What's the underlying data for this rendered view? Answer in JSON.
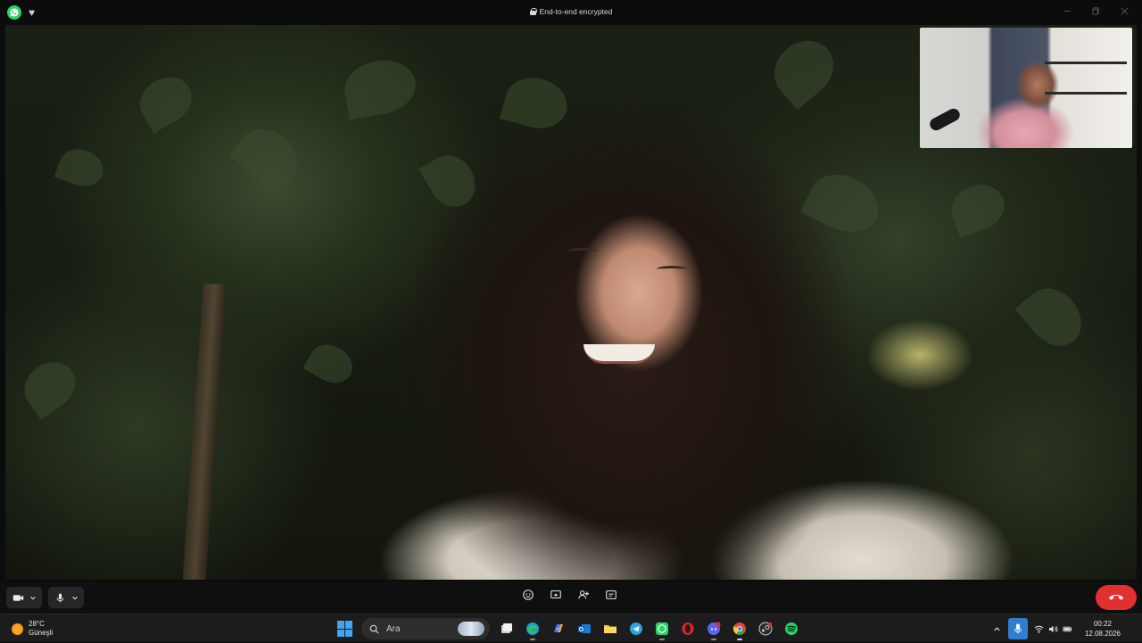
{
  "titlebar": {
    "encryption_label": "End-to-end encrypted",
    "app_icon": "whatsapp-icon",
    "secondary_icon": "heart-icon"
  },
  "window_controls": [
    "minimize",
    "maximize",
    "close"
  ],
  "call_controls": {
    "left": [
      {
        "icon": "video-camera-icon"
      },
      {
        "icon": "microphone-icon"
      }
    ],
    "center": [
      {
        "icon": "emoji-icon"
      },
      {
        "icon": "screen-share-icon"
      },
      {
        "icon": "add-person-icon"
      },
      {
        "icon": "more-options-icon"
      }
    ],
    "end_call_icon": "phone-hangup-icon",
    "end_call_color": "#e0302f"
  },
  "taskbar": {
    "weather": {
      "temp": "28°C",
      "location": "Güneşli",
      "icon": "sun-icon"
    },
    "search": {
      "placeholder": "Ara"
    },
    "apps": [
      {
        "name": "task-view",
        "icon": "task-view-icon"
      },
      {
        "name": "edge",
        "icon": "edge-icon"
      },
      {
        "name": "copilot",
        "icon": "copilot-icon"
      },
      {
        "name": "outlook",
        "icon": "outlook-icon"
      },
      {
        "name": "file-explorer",
        "icon": "folder-icon"
      },
      {
        "name": "telegram",
        "icon": "telegram-icon"
      },
      {
        "name": "whatsapp",
        "icon": "whatsapp-icon"
      },
      {
        "name": "opera",
        "icon": "opera-icon"
      },
      {
        "name": "discord",
        "icon": "discord-icon"
      },
      {
        "name": "chrome",
        "icon": "chrome-icon"
      },
      {
        "name": "steam",
        "icon": "steam-icon"
      },
      {
        "name": "spotify",
        "icon": "spotify-icon"
      }
    ],
    "tray": {
      "time": "00:22",
      "date": "12.08.2026"
    }
  },
  "colors": {
    "accent_blue": "#2f7fd0",
    "whatsapp_green": "#2ad366",
    "end_call_red": "#e0302f"
  }
}
